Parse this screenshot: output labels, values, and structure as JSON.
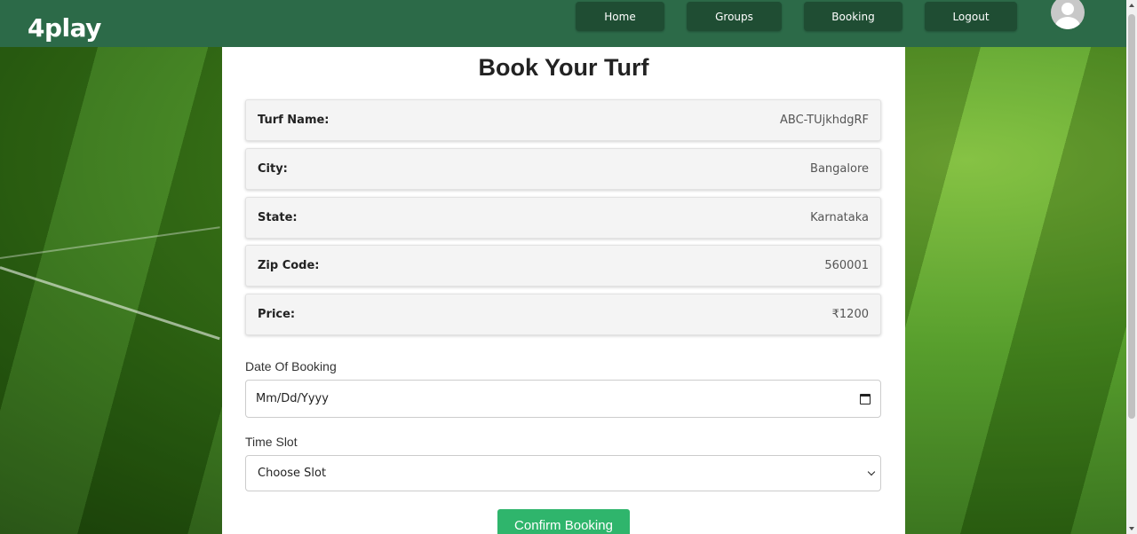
{
  "navbar": {
    "brand": "4play",
    "links": [
      "Home",
      "Groups",
      "Booking",
      "Logout"
    ]
  },
  "form": {
    "title": "Book Your Turf",
    "info": [
      {
        "label": "Turf Name:",
        "value": "ABC-TUjkhdgRF"
      },
      {
        "label": "City:",
        "value": "Bangalore"
      },
      {
        "label": "State:",
        "value": "Karnataka"
      },
      {
        "label": "Zip Code:",
        "value": "560001"
      },
      {
        "label": "Price:",
        "value": "₹1200"
      }
    ],
    "date_label": "Date Of Booking",
    "date_placeholder": "Mm/Dd/Yyyy",
    "slot_label": "Time Slot",
    "slot_value": "Choose Slot",
    "confirm_label": "Confirm Booking"
  },
  "colors": {
    "navbar": "#2c6a48",
    "nav_button": "#1f4d33",
    "confirm": "#2fb56c"
  }
}
